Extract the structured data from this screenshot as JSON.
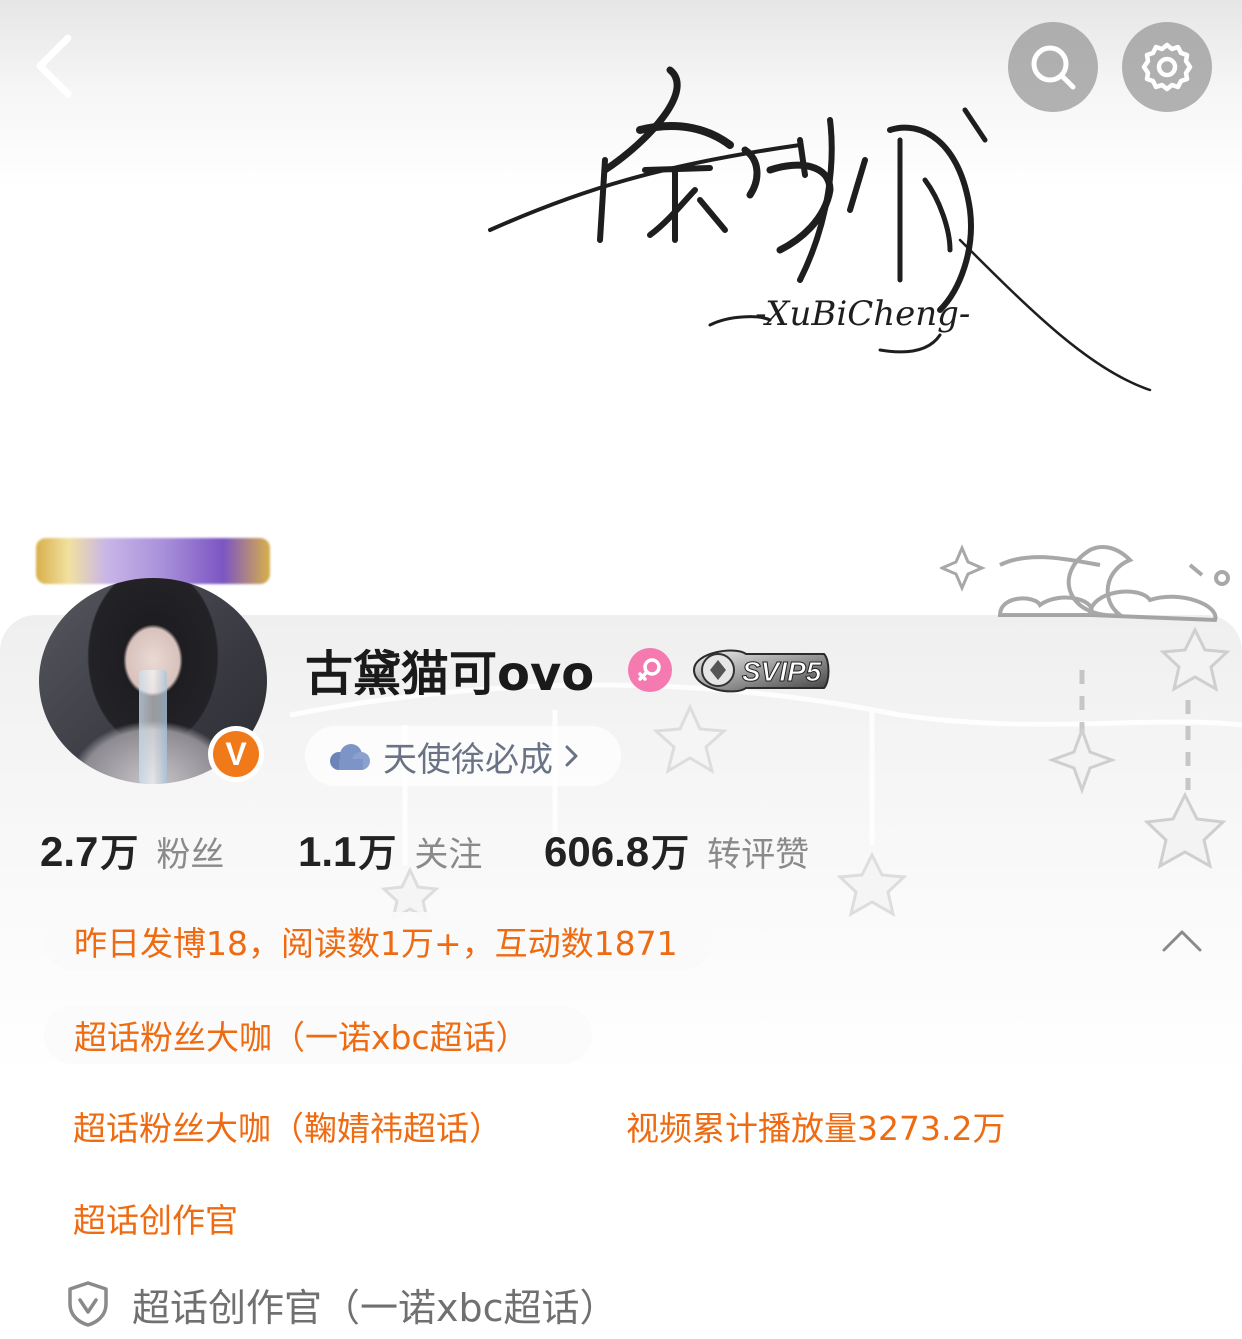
{
  "header": {
    "back_icon": "chevron-left-icon",
    "search_icon": "search-icon",
    "settings_icon": "gear-icon"
  },
  "banner": {
    "title_calligraphy": "徐必成",
    "subtitle": "-XuBiCheng-"
  },
  "profile": {
    "username": "古黛猫可ovo",
    "gender_icon": "female-icon",
    "verified_icon": "V",
    "svip_badge": "SVIP5",
    "angel_label": "天使徐必成"
  },
  "stats": [
    {
      "value": "2.7",
      "unit": "万",
      "label": "粉丝"
    },
    {
      "value": "1.1",
      "unit": "万",
      "label": "关注"
    },
    {
      "value": "606.8",
      "unit": "万",
      "label": "转评赞"
    }
  ],
  "highlights": {
    "activity": "昨日发博18，阅读数1万+，互动数1871",
    "supertopic_1": "超话粉丝大咖（一诺xbc超话）",
    "supertopic_2": "超话粉丝大咖（鞠婧祎超话）",
    "video_views": "视频累计播放量3273.2万",
    "creator": "超话创作官",
    "creator_full": "超话创作官（一诺xbc超话）"
  },
  "colors": {
    "accent_orange": "#ef6b12",
    "verified_orange": "#f07a1a",
    "gender_pink": "#f47ab0"
  }
}
